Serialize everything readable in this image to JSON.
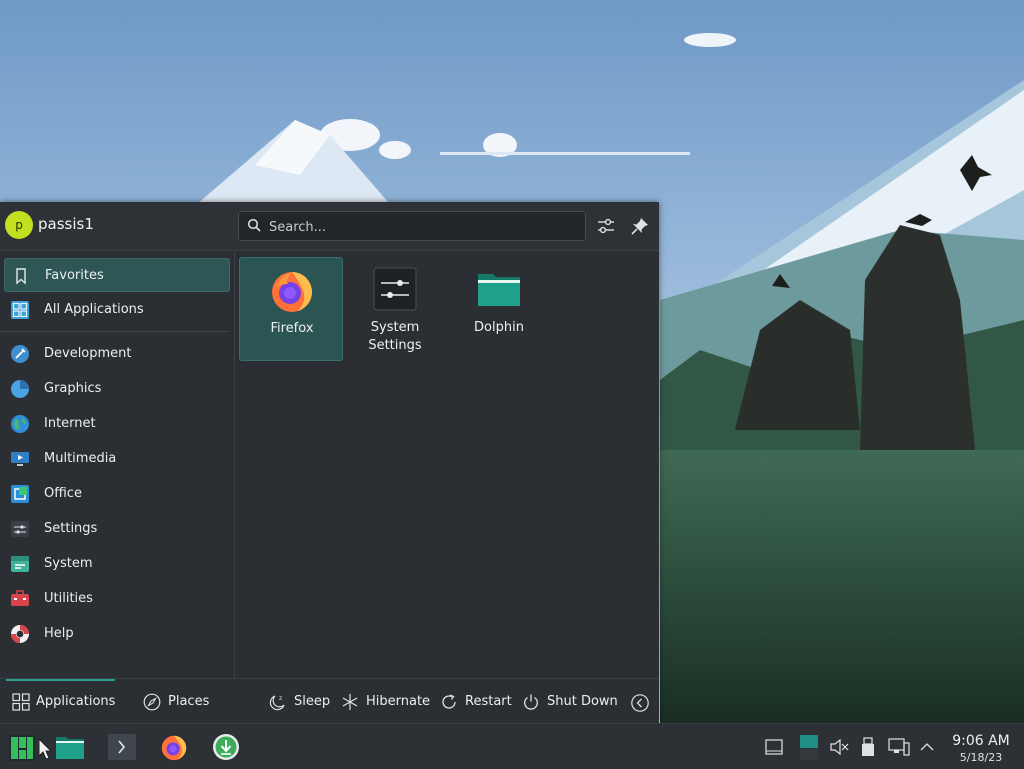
{
  "user": {
    "initial": "p",
    "name": "passis1"
  },
  "search": {
    "placeholder": "Search..."
  },
  "categories": [
    {
      "label": "Favorites",
      "icon": "bookmark-icon",
      "selected": true
    },
    {
      "label": "All Applications",
      "icon": "grid-icon"
    },
    {
      "label": "Development",
      "icon": "development-icon"
    },
    {
      "label": "Graphics",
      "icon": "graphics-icon"
    },
    {
      "label": "Internet",
      "icon": "globe-icon"
    },
    {
      "label": "Multimedia",
      "icon": "multimedia-icon"
    },
    {
      "label": "Office",
      "icon": "office-icon"
    },
    {
      "label": "Settings",
      "icon": "settings-icon"
    },
    {
      "label": "System",
      "icon": "system-icon"
    },
    {
      "label": "Utilities",
      "icon": "utilities-icon"
    },
    {
      "label": "Help",
      "icon": "help-icon"
    }
  ],
  "favorites": [
    {
      "label": "Firefox",
      "icon": "firefox-icon",
      "selected": true
    },
    {
      "label": "System Settings",
      "icon": "system-settings-icon"
    },
    {
      "label": "Dolphin",
      "icon": "dolphin-folder-icon"
    }
  ],
  "footer": {
    "tabs": {
      "applications": "Applications",
      "places": "Places"
    },
    "power": {
      "sleep": "Sleep",
      "hibernate": "Hibernate",
      "restart": "Restart",
      "shutdown": "Shut Down"
    }
  },
  "clock": {
    "time": "9:06 AM",
    "date": "5/18/23"
  },
  "colors": {
    "accent": "#2a9d8f",
    "panel": "#2b2f33",
    "selection": "#2e5654",
    "avatar": "#c2e01f"
  }
}
